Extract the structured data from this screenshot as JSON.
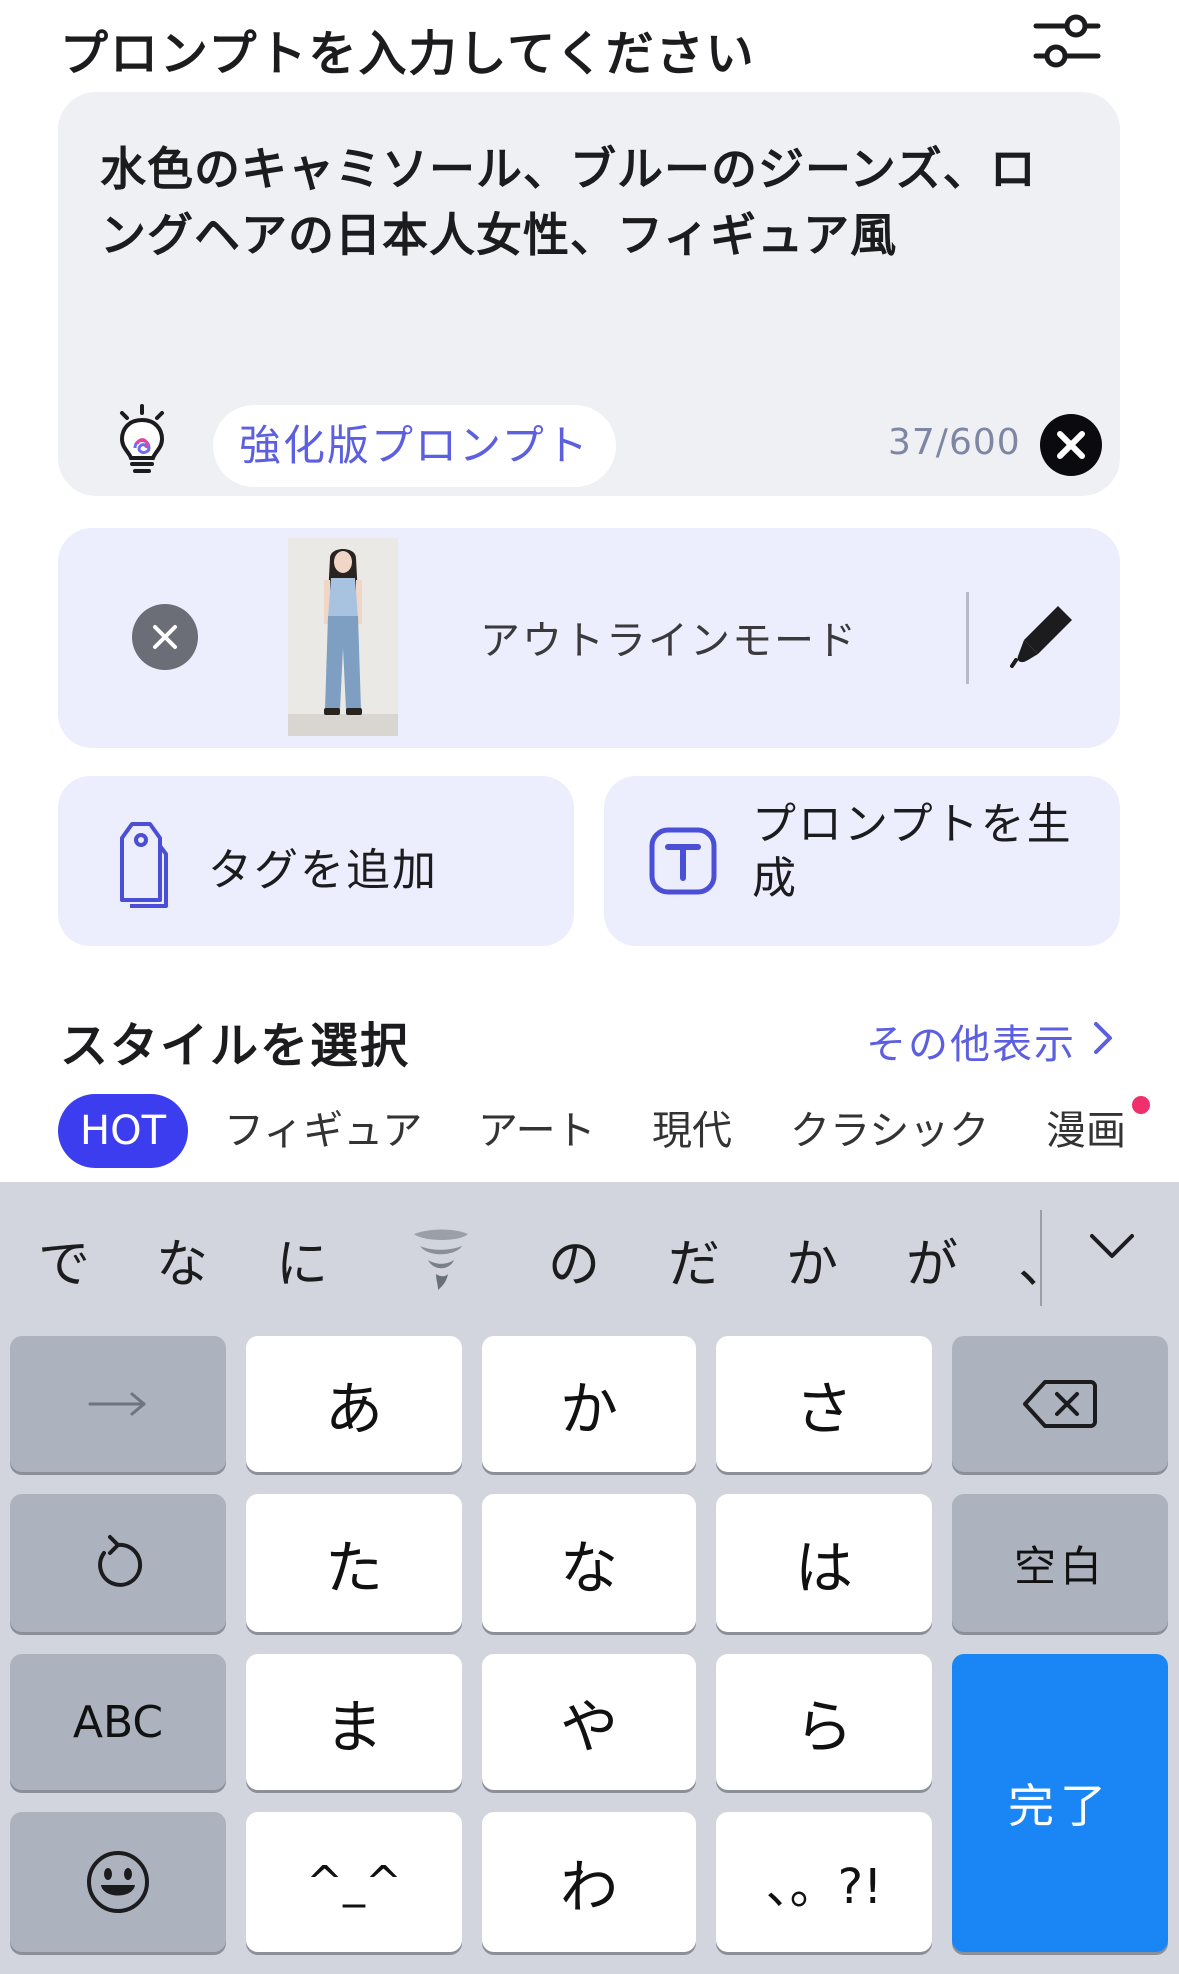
{
  "header": {
    "title": "プロンプトを入力してください",
    "settings_icon": "sliders-icon"
  },
  "prompt": {
    "text": "水色のキャミソール、ブルーのジーンズ、ロングヘアの日本人女性、フィギュア風",
    "enhance_label": "強化版プロンプト",
    "char_count": "37/600",
    "icons": {
      "bulb": "lightbulb-icon",
      "clear": "close-circle-icon"
    }
  },
  "reference": {
    "mode_label": "アウトラインモード",
    "icons": {
      "remove": "close-icon",
      "edit": "pen-icon"
    }
  },
  "actions": {
    "add_tag": "タグを追加",
    "generate_prompt": "プロンプトを生成"
  },
  "styles": {
    "heading": "スタイルを選択",
    "show_more": "その他表示",
    "chips": [
      "HOT",
      "フィギュア",
      "アート",
      "現代",
      "クラシック",
      "漫画"
    ],
    "active_chip": "HOT"
  },
  "keyboard": {
    "candidates": [
      "で",
      "な",
      "に",
      "🌪️",
      "の",
      "だ",
      "か",
      "が",
      "、"
    ],
    "rows": [
      [
        "→",
        "あ",
        "か",
        "さ",
        "⌫"
      ],
      [
        "↺",
        "た",
        "な",
        "は",
        "空白"
      ],
      [
        "ABC",
        "ま",
        "や",
        "ら",
        "完了"
      ],
      [
        "☺",
        "^_^",
        "わ",
        "、。?!"
      ]
    ],
    "space_label": "空白",
    "done_label": "完了",
    "abc_label": "ABC"
  },
  "colors": {
    "accent": "#5b5fe0",
    "chip_active": "#3d3df0",
    "done_key": "#1a86f5",
    "card_bg": "#eef0f4",
    "lavender_bg": "#eceefd",
    "keyboard_bg": "#d2d5dd"
  }
}
